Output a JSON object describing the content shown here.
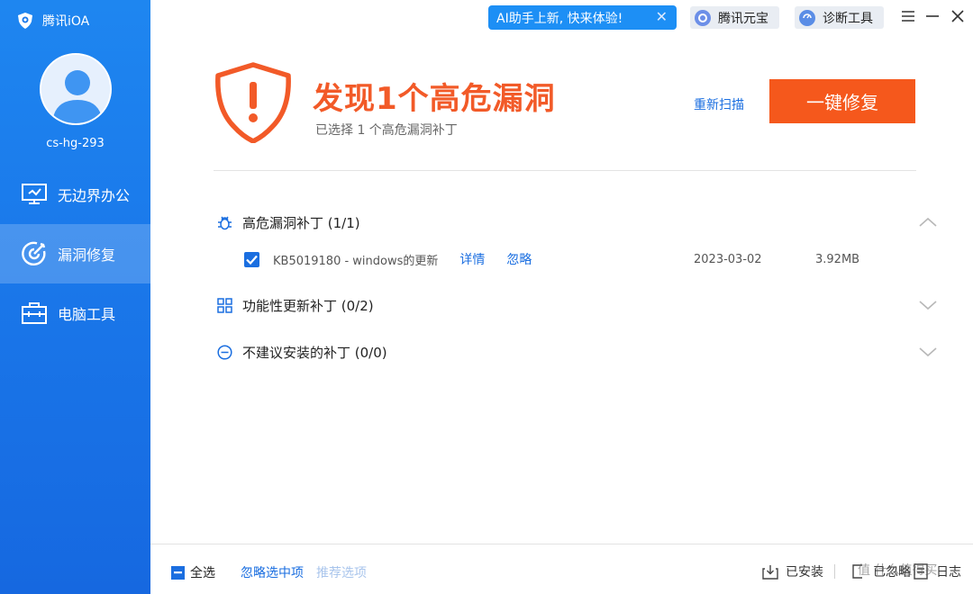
{
  "app": {
    "name": "腾讯iOA",
    "username": "cs-hg-293"
  },
  "sidebar": {
    "items": [
      {
        "label": "无边界办公",
        "icon": "monitor-icon",
        "active": false
      },
      {
        "label": "漏洞修复",
        "icon": "target-icon",
        "active": true
      },
      {
        "label": "电脑工具",
        "icon": "toolbox-icon",
        "active": false
      }
    ]
  },
  "topbar": {
    "ai_promo": "AI助手上新, 快来体验!",
    "tool_1": "腾讯元宝",
    "tool_2": "诊断工具"
  },
  "header": {
    "headline": "发现1个高危漏洞",
    "subline": "已选择 1 个高危漏洞补丁",
    "rescan": "重新扫描",
    "fix_button": "一键修复"
  },
  "sections": [
    {
      "title": "高危漏洞补丁 (1/1)",
      "expanded": true,
      "icon": "bug-icon"
    },
    {
      "title": "功能性更新补丁 (0/2)",
      "expanded": false,
      "icon": "grid-icon"
    },
    {
      "title": "不建议安装的补丁 (0/0)",
      "expanded": false,
      "icon": "minus-circle-icon"
    }
  ],
  "patches": [
    {
      "name": "KB5019180 - windows的更新",
      "details": "详情",
      "ignore": "忽略",
      "date": "2023-03-02",
      "size": "3.92MB",
      "checked": true
    }
  ],
  "footer": {
    "select_all": "全选",
    "ignore_selected": "忽略选中项",
    "recommended": "推荐选项",
    "installed": "已安装",
    "ignored": "已忽略",
    "log": "日志"
  },
  "watermark": "值 什么值得买",
  "colors": {
    "sidebar": "#1a78ea",
    "accent": "#1a6ee0",
    "danger": "#f25a28",
    "fix_button": "#f5581c"
  }
}
